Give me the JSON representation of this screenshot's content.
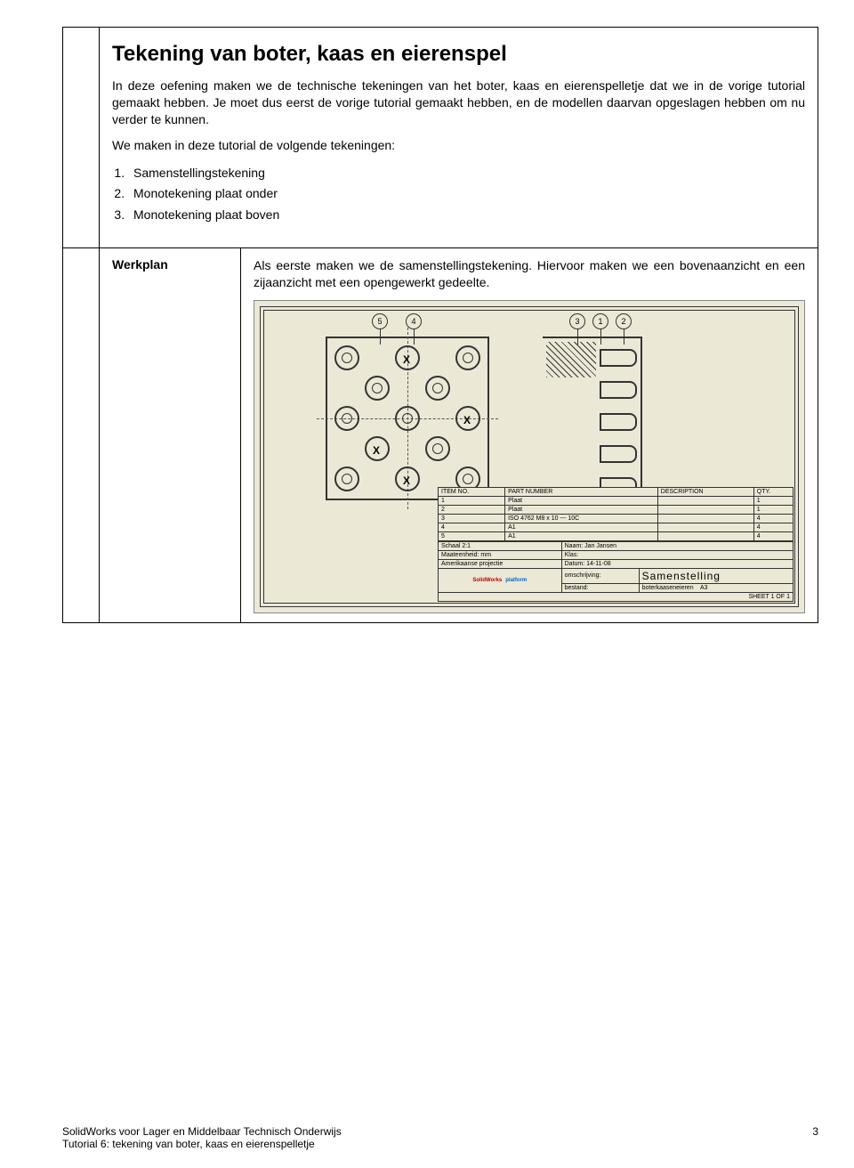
{
  "title": "Tekening van boter, kaas en eierenspel",
  "intro1": "In deze oefening maken we de technische tekeningen van het boter, kaas en eierenspelletje dat we in de vorige tutorial gemaakt hebben. Je moet dus eerst de vorige tutorial gemaakt hebben, en de modellen daarvan opgeslagen hebben om nu verder te kunnen.",
  "intro2": "We maken in deze tutorial de volgende tekeningen:",
  "steps": [
    "Samenstellingstekening",
    "Monotekening plaat onder",
    "Monotekening plaat boven"
  ],
  "werkplan_label": "Werkplan",
  "werkplan_text": "Als eerste maken we de samenstellingstekening. Hiervoor maken we een bovenaanzicht en een zijaanzicht met een opengewerkt gedeelte.",
  "balloons": [
    "5",
    "4",
    "3",
    "1",
    "2"
  ],
  "bom": {
    "headers": [
      "ITEM NO.",
      "PART NUMBER",
      "DESCRIPTION",
      "QTY."
    ],
    "rows": [
      [
        "1",
        "Plaat",
        "",
        "1"
      ],
      [
        "2",
        "Plaat",
        "",
        "1"
      ],
      [
        "3",
        "ISO 4762 M8 x 10 --- 10C",
        "",
        "4"
      ],
      [
        "4",
        "A1",
        "",
        "4"
      ],
      [
        "5",
        "A1",
        "",
        "4"
      ]
    ]
  },
  "titleblock": {
    "schaal_label": "Schaal 2:1",
    "naam_label": "Naam: Jan Jansen",
    "maat_label": "Maateenheid: mm",
    "klas_label": "Klas:",
    "proj_label": "Amerikaanse projectie",
    "datum_label": "Datum: 14-11-08",
    "omschrijving_label": "omschrijving:",
    "omschrijving": "Samenstelling",
    "bestand_label": "bestand:",
    "bestand": "boterkaaseneieren",
    "formaat": "A3",
    "sheet": "SHEET 1 OF 1"
  },
  "footer": {
    "left1": "SolidWorks voor Lager en Middelbaar Technisch Onderwijs",
    "left2": "Tutorial 6: tekening van boter, kaas en eierenspelletje",
    "page": "3"
  }
}
